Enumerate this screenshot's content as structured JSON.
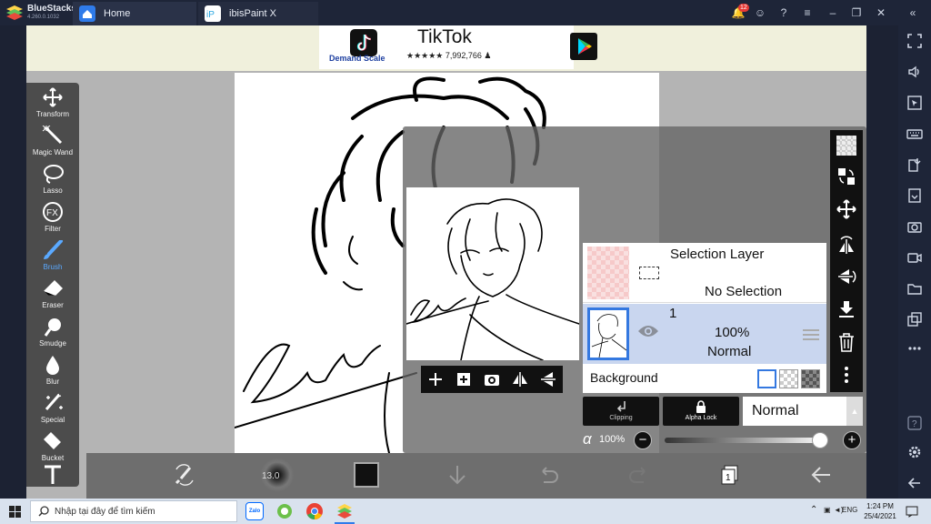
{
  "bluestacks": {
    "brand": "BlueStacks",
    "version": "4.260.0.1032",
    "tabs": [
      {
        "label": "Home",
        "icon": "home-icon"
      },
      {
        "label": "ibisPaint X",
        "icon": "ibispaint-app-icon"
      }
    ],
    "notification_count": "12",
    "sidebar_icons": [
      "fullscreen-icon",
      "volume-icon",
      "pointer-icon",
      "keyboard-icon",
      "install-apk-icon",
      "apk-icon",
      "screenshot-icon",
      "record-icon",
      "folder-icon",
      "multi-instance-icon",
      "more-icon",
      "help-icon",
      "settings-icon",
      "back-icon"
    ]
  },
  "ad": {
    "title": "TikTok",
    "rating": "★★★★★ 7,992,766 ♟",
    "sub": "Demand Scale"
  },
  "tools": [
    {
      "label": "Transform",
      "icon": "transform-icon"
    },
    {
      "label": "Magic Wand",
      "icon": "magic-wand-icon"
    },
    {
      "label": "Lasso",
      "icon": "lasso-icon"
    },
    {
      "label": "Filter",
      "icon": "filter-fx-icon"
    },
    {
      "label": "Brush",
      "icon": "brush-icon",
      "active": true
    },
    {
      "label": "Eraser",
      "icon": "eraser-icon"
    },
    {
      "label": "Smudge",
      "icon": "smudge-icon"
    },
    {
      "label": "Blur",
      "icon": "blur-icon"
    },
    {
      "label": "Special",
      "icon": "special-icon"
    },
    {
      "label": "Bucket",
      "icon": "bucket-icon"
    },
    {
      "label": "",
      "icon": "text-tool-icon"
    }
  ],
  "bottom_bar": {
    "brush_size": "13.0",
    "color": "#111111"
  },
  "layers": {
    "selection": {
      "title": "Selection Layer",
      "status": "No Selection"
    },
    "layer1": {
      "number": "1",
      "opacity": "100%",
      "blend": "Normal"
    },
    "background": {
      "label": "Background"
    }
  },
  "layer_controls": {
    "clipping": "Clipping",
    "alpha_lock": "Alpha Lock",
    "blend_mode": "Normal",
    "opacity_symbol": "α",
    "opacity": "100%",
    "opacity_fraction": 1.0
  },
  "taskbar": {
    "search_placeholder": "Nhập tại đây để tìm kiếm",
    "lang": "ENG",
    "time": "1:24 PM",
    "date": "25/4/2021"
  }
}
